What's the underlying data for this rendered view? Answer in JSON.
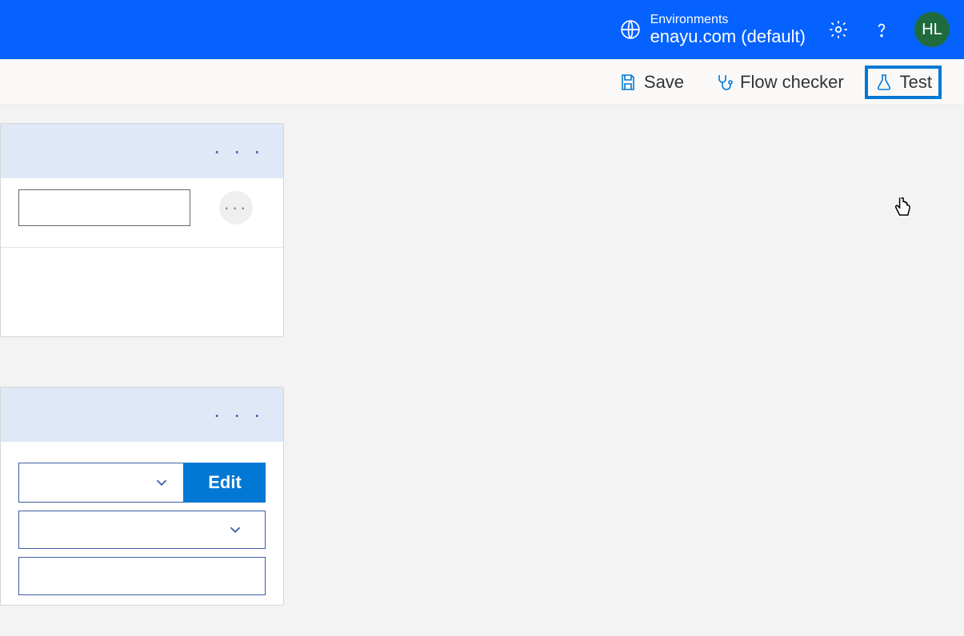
{
  "header": {
    "env_label": "Environments",
    "env_name": "enayu.com (default)",
    "avatar_initials": "HL"
  },
  "toolbar": {
    "save_label": "Save",
    "flowchecker_label": "Flow checker",
    "test_label": "Test"
  },
  "card2": {
    "edit_label": "Edit"
  }
}
